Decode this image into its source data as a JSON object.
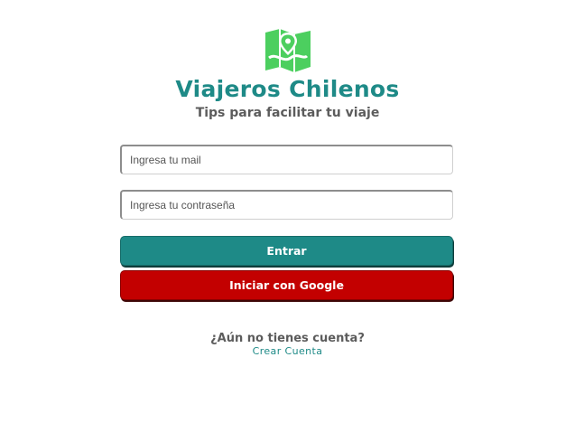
{
  "brand": {
    "title": "Viajeros Chilenos",
    "subtitle": "Tips para facilitar tu viaje",
    "logo_icon": "map-pin-icon",
    "accent_color": "#1e8a87",
    "logo_color": "#4ccf5f"
  },
  "login_form": {
    "email_placeholder": "Ingresa tu mail",
    "email_value": "",
    "password_placeholder": "Ingresa tu contraseña",
    "password_value": "",
    "enter_label": "Entrar",
    "google_label": "Iniciar con Google",
    "google_color": "#c30000"
  },
  "signup": {
    "prompt": "¿Aún no tienes cuenta?",
    "link_label": "Crear Cuenta"
  }
}
